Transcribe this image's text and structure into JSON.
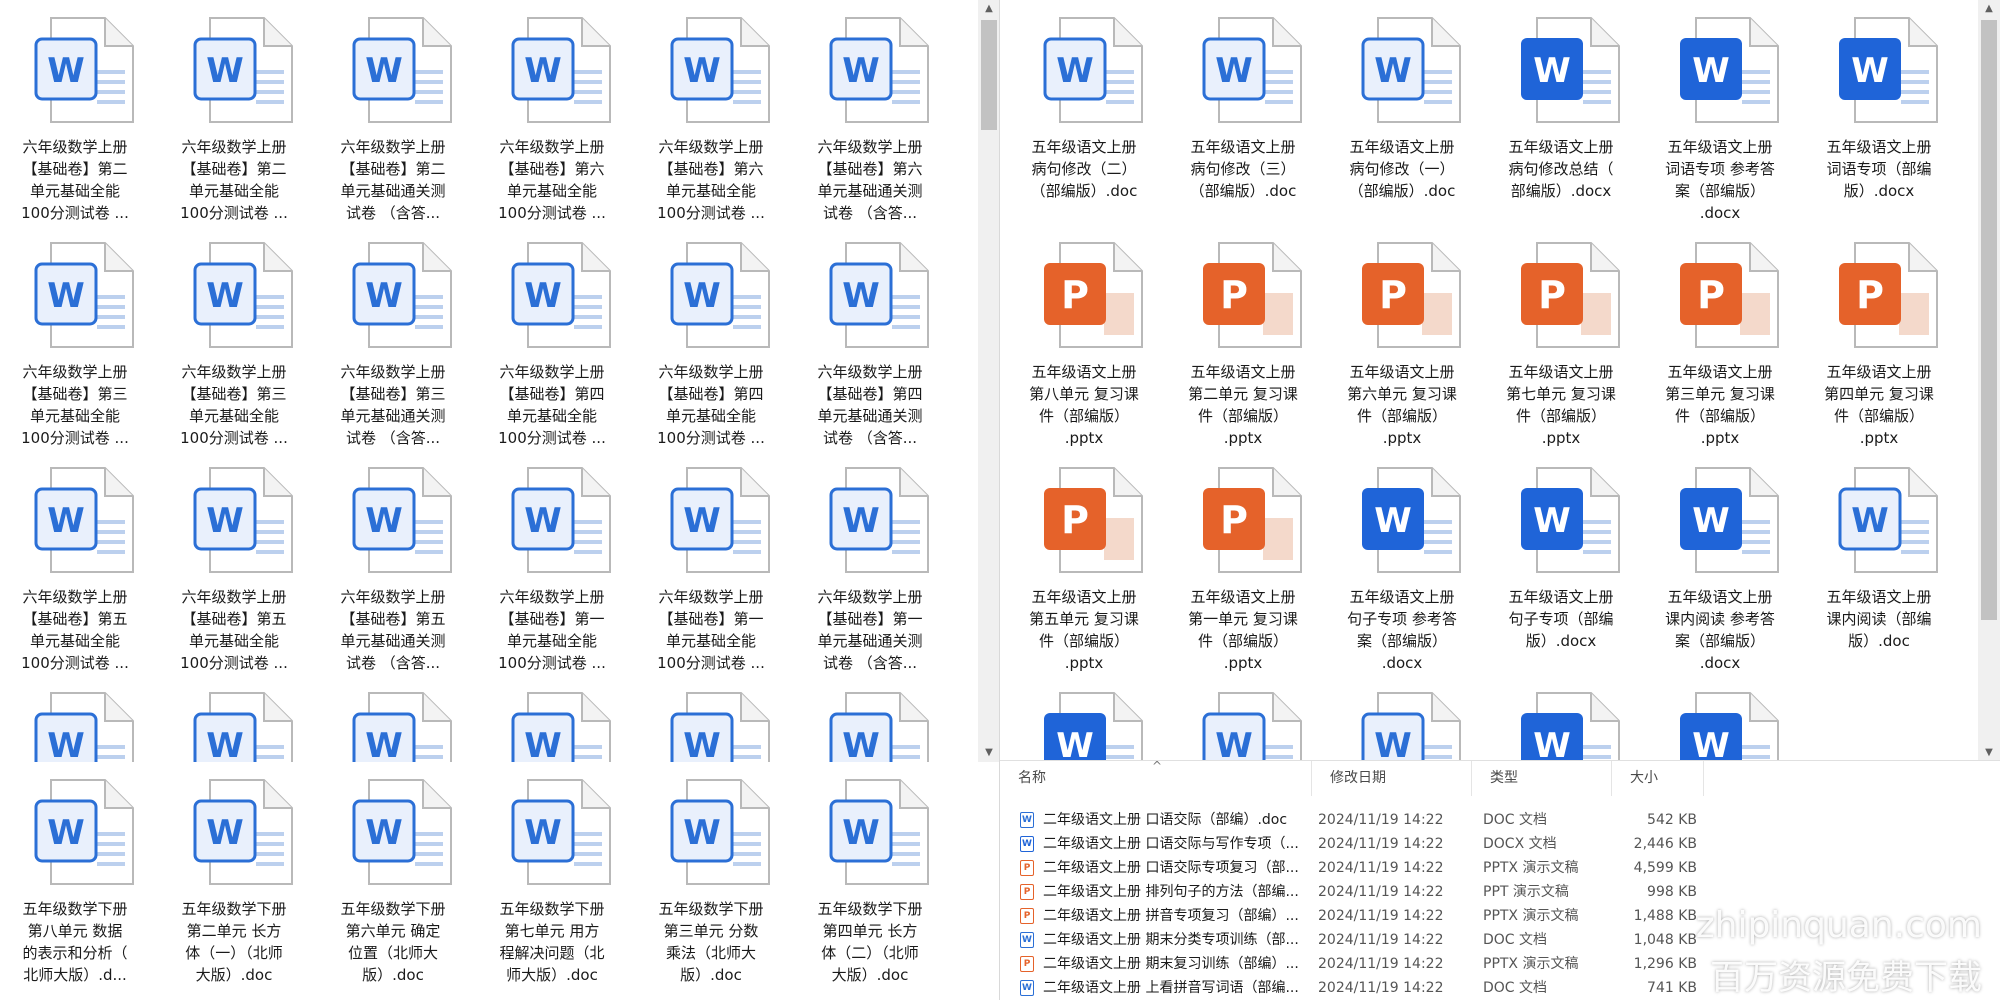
{
  "left_pane": {
    "tiles": [
      {
        "type": "doc",
        "name": "六年级数学上册\n【基础卷】第二\n单元基础全能\n100分测试卷  ..."
      },
      {
        "type": "doc",
        "name": "六年级数学上册\n【基础卷】第二\n单元基础全能\n100分测试卷  ..."
      },
      {
        "type": "doc",
        "name": "六年级数学上册\n【基础卷】第二\n单元基础通关测\n试卷  （含答..."
      },
      {
        "type": "doc",
        "name": "六年级数学上册\n【基础卷】第六\n单元基础全能\n100分测试卷  ..."
      },
      {
        "type": "doc",
        "name": "六年级数学上册\n【基础卷】第六\n单元基础全能\n100分测试卷  ..."
      },
      {
        "type": "doc",
        "name": "六年级数学上册\n【基础卷】第六\n单元基础通关测\n试卷  （含答..."
      },
      {
        "type": "doc",
        "name": "六年级数学上册\n【基础卷】第三\n单元基础全能\n100分测试卷  ..."
      },
      {
        "type": "doc",
        "name": "六年级数学上册\n【基础卷】第三\n单元基础全能\n100分测试卷  ..."
      },
      {
        "type": "doc",
        "name": "六年级数学上册\n【基础卷】第三\n单元基础通关测\n试卷  （含答..."
      },
      {
        "type": "doc",
        "name": "六年级数学上册\n【基础卷】第四\n单元基础全能\n100分测试卷  ..."
      },
      {
        "type": "doc",
        "name": "六年级数学上册\n【基础卷】第四\n单元基础全能\n100分测试卷  ..."
      },
      {
        "type": "doc",
        "name": "六年级数学上册\n【基础卷】第四\n单元基础通关测\n试卷  （含答..."
      },
      {
        "type": "doc",
        "name": "六年级数学上册\n【基础卷】第五\n单元基础全能\n100分测试卷  ..."
      },
      {
        "type": "doc",
        "name": "六年级数学上册\n【基础卷】第五\n单元基础全能\n100分测试卷  ..."
      },
      {
        "type": "doc",
        "name": "六年级数学上册\n【基础卷】第五\n单元基础通关测\n试卷  （含答..."
      },
      {
        "type": "doc",
        "name": "六年级数学上册\n【基础卷】第一\n单元基础全能\n100分测试卷  ..."
      },
      {
        "type": "doc",
        "name": "六年级数学上册\n【基础卷】第一\n单元基础全能\n100分测试卷  ..."
      },
      {
        "type": "doc",
        "name": "六年级数学上册\n【基础卷】第一\n单元基础通关测\n试卷  （含答..."
      },
      {
        "type": "doc",
        "name": ""
      },
      {
        "type": "doc",
        "name": ""
      },
      {
        "type": "doc",
        "name": ""
      },
      {
        "type": "doc",
        "name": ""
      },
      {
        "type": "doc",
        "name": ""
      },
      {
        "type": "doc",
        "name": ""
      }
    ]
  },
  "bottom_left_pane": {
    "tiles": [
      {
        "type": "doc",
        "name": "五年级数学下册\n第八单元  数据\n的表示和分析（\n北师大版）.d..."
      },
      {
        "type": "doc",
        "name": "五年级数学下册\n第二单元  长方\n体（一）（北师\n大版）.doc"
      },
      {
        "type": "doc",
        "name": "五年级数学下册\n第六单元  确定\n位置（北师大\n版）.doc"
      },
      {
        "type": "doc",
        "name": "五年级数学下册\n第七单元  用方\n程解决问题（北\n师大版）.doc"
      },
      {
        "type": "doc",
        "name": "五年级数学下册\n第三单元  分数\n乘法（北师大\n版）.doc"
      },
      {
        "type": "doc",
        "name": "五年级数学下册\n第四单元  长方\n体（二）（北师\n大版）.doc"
      }
    ]
  },
  "right_pane": {
    "tiles": [
      {
        "type": "doc",
        "name": "五年级语文上册\n病句修改（二）\n（部编版）.doc"
      },
      {
        "type": "doc",
        "name": "五年级语文上册\n病句修改（三）\n（部编版）.doc"
      },
      {
        "type": "doc",
        "name": "五年级语文上册\n病句修改（一）\n（部编版）.doc"
      },
      {
        "type": "docx",
        "name": "五年级语文上册\n病句修改总结（\n部编版）.docx"
      },
      {
        "type": "docx",
        "name": "五年级语文上册\n词语专项 参考答\n案（部编版）\n.docx"
      },
      {
        "type": "docx",
        "name": "五年级语文上册\n词语专项（部编\n版）.docx"
      },
      {
        "type": "pptx",
        "name": "五年级语文上册\n第八单元 复习课\n件（部编版）\n.pptx"
      },
      {
        "type": "pptx",
        "name": "五年级语文上册\n第二单元 复习课\n件（部编版）\n.pptx"
      },
      {
        "type": "pptx",
        "name": "五年级语文上册\n第六单元 复习课\n件（部编版）\n.pptx"
      },
      {
        "type": "pptx",
        "name": "五年级语文上册\n第七单元 复习课\n件（部编版）\n.pptx"
      },
      {
        "type": "pptx",
        "name": "五年级语文上册\n第三单元 复习课\n件（部编版）\n.pptx"
      },
      {
        "type": "pptx",
        "name": "五年级语文上册\n第四单元 复习课\n件（部编版）\n.pptx"
      },
      {
        "type": "pptx",
        "name": "五年级语文上册\n第五单元 复习课\n件（部编版）\n.pptx"
      },
      {
        "type": "pptx",
        "name": "五年级语文上册\n第一单元 复习课\n件（部编版）\n.pptx"
      },
      {
        "type": "docx",
        "name": "五年级语文上册\n句子专项 参考答\n案（部编版）\n.docx"
      },
      {
        "type": "docx",
        "name": "五年级语文上册\n句子专项（部编\n版）.docx"
      },
      {
        "type": "docx",
        "name": "五年级语文上册\n课内阅读 参考答\n案（部编版）\n.docx"
      },
      {
        "type": "doc",
        "name": "五年级语文上册\n课内阅读（部编\n版）.doc"
      },
      {
        "type": "docx",
        "name": ""
      },
      {
        "type": "doc",
        "name": ""
      },
      {
        "type": "doc",
        "name": ""
      },
      {
        "type": "docx",
        "name": ""
      },
      {
        "type": "docx",
        "name": ""
      }
    ]
  },
  "details": {
    "columns": {
      "name": "名称",
      "date": "修改日期",
      "type": "类型",
      "size": "大小"
    },
    "sort_indicator": "^",
    "rows": [
      {
        "icon": "doc",
        "name": "二年级语文上册    口语交际（部编）.doc",
        "date": "2024/11/19 14:22",
        "type": "DOC 文档",
        "size": "542 KB"
      },
      {
        "icon": "docx",
        "name": "二年级语文上册    口语交际与写作专项（...",
        "date": "2024/11/19 14:22",
        "type": "DOCX 文档",
        "size": "2,446 KB"
      },
      {
        "icon": "pptx",
        "name": "二年级语文上册    口语交际专项复习（部...",
        "date": "2024/11/19 14:22",
        "type": "PPTX 演示文稿",
        "size": "4,599 KB"
      },
      {
        "icon": "ppt",
        "name": "二年级语文上册    排列句子的方法（部编...",
        "date": "2024/11/19 14:22",
        "type": "PPT 演示文稿",
        "size": "998 KB"
      },
      {
        "icon": "pptx",
        "name": "二年级语文上册    拼音专项复习（部编）...",
        "date": "2024/11/19 14:22",
        "type": "PPTX 演示文稿",
        "size": "1,488 KB"
      },
      {
        "icon": "doc",
        "name": "二年级语文上册    期末分类专项训练（部...",
        "date": "2024/11/19 14:22",
        "type": "DOC 文档",
        "size": "1,048 KB"
      },
      {
        "icon": "pptx",
        "name": "二年级语文上册    期末复习训练（部编）...",
        "date": "2024/11/19 14:22",
        "type": "PPTX 演示文稿",
        "size": "1,296 KB"
      },
      {
        "icon": "doc",
        "name": "二年级语文上册    上看拼音写词语（部编...",
        "date": "2024/11/19 14:22",
        "type": "DOC 文档",
        "size": "741 KB"
      }
    ]
  },
  "watermark": {
    "line1": "zhipinquan.com",
    "line2": "百万资源免费下载"
  },
  "colors": {
    "doc_blue": "#2b6fd6",
    "docx_blue": "#1f64d8",
    "ppt_orange": "#e5622a"
  }
}
